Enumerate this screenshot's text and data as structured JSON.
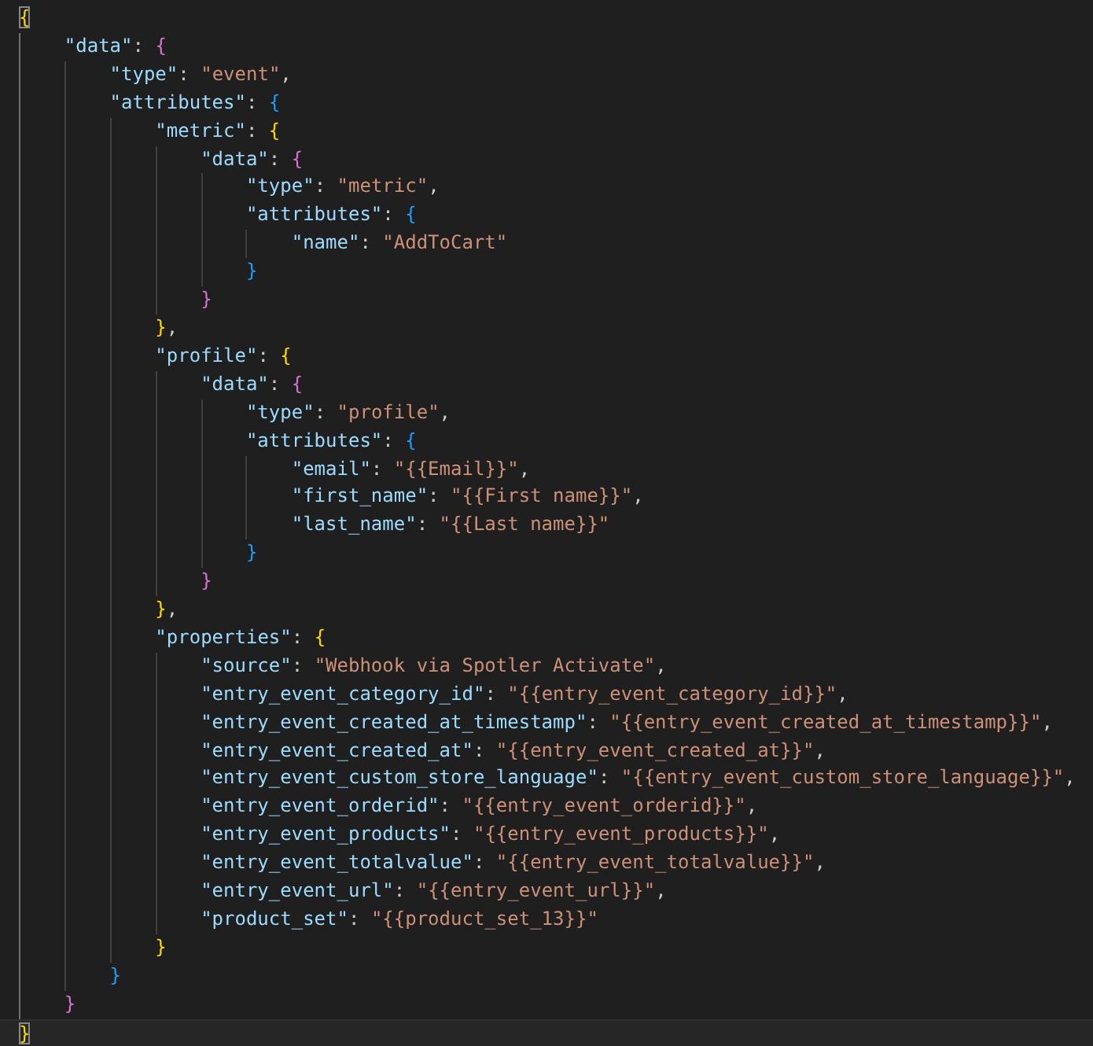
{
  "editor": {
    "document": {
      "open": "{",
      "close": "}",
      "matched": true,
      "cursor_on_close": true,
      "children": [
        {
          "key": "\"data\"",
          "sep": ": ",
          "open": "{",
          "close": "}",
          "children": [
            {
              "key": "\"type\"",
              "sep": ": ",
              "value": "\"event\"",
              "end": ","
            },
            {
              "key": "\"attributes\"",
              "sep": ": ",
              "open": "{",
              "close": "}",
              "children": [
                {
                  "key": "\"metric\"",
                  "sep": ": ",
                  "open": "{",
                  "close": "}",
                  "end": ",",
                  "children": [
                    {
                      "key": "\"data\"",
                      "sep": ": ",
                      "open": "{",
                      "close": "}",
                      "children": [
                        {
                          "key": "\"type\"",
                          "sep": ": ",
                          "value": "\"metric\"",
                          "end": ","
                        },
                        {
                          "key": "\"attributes\"",
                          "sep": ": ",
                          "open": "{",
                          "close": "}",
                          "children": [
                            {
                              "key": "\"name\"",
                              "sep": ": ",
                              "value": "\"AddToCart\""
                            }
                          ]
                        }
                      ]
                    }
                  ]
                },
                {
                  "key": "\"profile\"",
                  "sep": ": ",
                  "open": "{",
                  "close": "}",
                  "end": ",",
                  "children": [
                    {
                      "key": "\"data\"",
                      "sep": ": ",
                      "open": "{",
                      "close": "}",
                      "children": [
                        {
                          "key": "\"type\"",
                          "sep": ": ",
                          "value": "\"profile\"",
                          "end": ","
                        },
                        {
                          "key": "\"attributes\"",
                          "sep": ": ",
                          "open": "{",
                          "close": "}",
                          "children": [
                            {
                              "key": "\"email\"",
                              "sep": ": ",
                              "value": "\"{{Email}}\"",
                              "end": ","
                            },
                            {
                              "key": "\"first_name\"",
                              "sep": ": ",
                              "value": "\"{{First name}}\"",
                              "end": ","
                            },
                            {
                              "key": "\"last_name\"",
                              "sep": ": ",
                              "value": "\"{{Last name}}\""
                            }
                          ]
                        }
                      ]
                    }
                  ]
                },
                {
                  "key": "\"properties\"",
                  "sep": ": ",
                  "open": "{",
                  "close": "}",
                  "children": [
                    {
                      "key": "\"source\"",
                      "sep": ": ",
                      "value": "\"Webhook via Spotler Activate\"",
                      "end": ","
                    },
                    {
                      "key": "\"entry_event_category_id\"",
                      "sep": ": ",
                      "value": "\"{{entry_event_category_id}}\"",
                      "end": ","
                    },
                    {
                      "key": "\"entry_event_created_at_timestamp\"",
                      "sep": ": ",
                      "value": "\"{{entry_event_created_at_timestamp}}\"",
                      "end": ","
                    },
                    {
                      "key": "\"entry_event_created_at\"",
                      "sep": ": ",
                      "value": "\"{{entry_event_created_at}}\"",
                      "end": ","
                    },
                    {
                      "key": "\"entry_event_custom_store_language\"",
                      "sep": ": ",
                      "value": "\"{{entry_event_custom_store_language}}\"",
                      "end": ","
                    },
                    {
                      "key": "\"entry_event_orderid\"",
                      "sep": ": ",
                      "value": "\"{{entry_event_orderid}}\"",
                      "end": ","
                    },
                    {
                      "key": "\"entry_event_products\"",
                      "sep": ": ",
                      "value": "\"{{entry_event_products}}\"",
                      "end": ","
                    },
                    {
                      "key": "\"entry_event_totalvalue\"",
                      "sep": ": ",
                      "value": "\"{{entry_event_totalvalue}}\"",
                      "end": ","
                    },
                    {
                      "key": "\"entry_event_url\"",
                      "sep": ": ",
                      "value": "\"{{entry_event_url}}\"",
                      "end": ","
                    },
                    {
                      "key": "\"product_set\"",
                      "sep": ": ",
                      "value": "\"{{product_set_13}}\""
                    }
                  ]
                }
              ]
            }
          ]
        }
      ]
    }
  }
}
